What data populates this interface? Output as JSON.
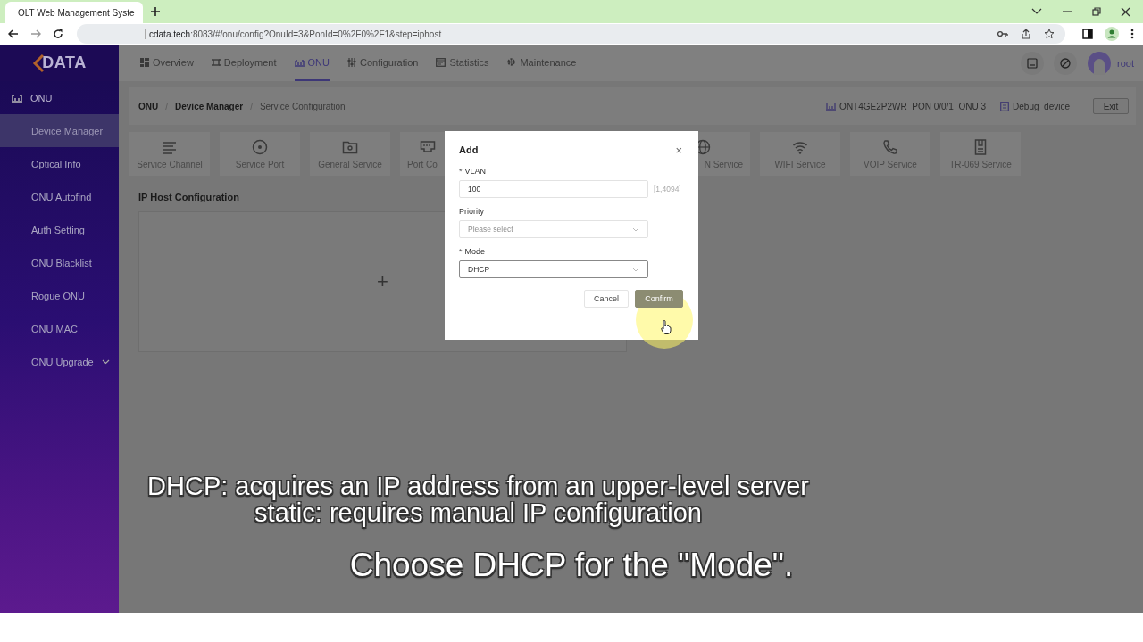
{
  "browser": {
    "tab_title": "OLT Web Management Syste",
    "url_host": "cdata.tech",
    "url_rest": ":8083/#/onu/config?OnuId=3&PonId=0%2F0%2F1&step=iphost"
  },
  "header": {
    "logo_text": "DATA",
    "nav": [
      {
        "label": "Overview",
        "selected": false
      },
      {
        "label": "Deployment",
        "selected": false
      },
      {
        "label": "ONU",
        "selected": true
      },
      {
        "label": "Configuration",
        "selected": false
      },
      {
        "label": "Statistics",
        "selected": false
      },
      {
        "label": "Maintenance",
        "selected": false
      }
    ],
    "user": "root"
  },
  "sidebar": {
    "title": "ONU",
    "items": [
      {
        "label": "Device Manager",
        "selected": true,
        "kind": "link"
      },
      {
        "label": "Optical Info",
        "selected": false,
        "kind": "link"
      },
      {
        "label": "ONU Autofind",
        "selected": false,
        "kind": "link"
      },
      {
        "label": "Auth Setting",
        "selected": false,
        "kind": "link"
      },
      {
        "label": "ONU Blacklist",
        "selected": false,
        "kind": "link"
      },
      {
        "label": "Rogue ONU",
        "selected": false,
        "kind": "link"
      },
      {
        "label": "ONU MAC",
        "selected": false,
        "kind": "link"
      },
      {
        "label": "ONU Upgrade",
        "selected": false,
        "kind": "submenu"
      }
    ]
  },
  "breadcrumb": [
    "ONU",
    "Device Manager",
    "Service Configuration"
  ],
  "breadcrumb_separator": "/",
  "device": {
    "name": "ONT4GE2P2WR_PON 0/0/1_ONU 3",
    "profile": "Debug_device",
    "exit": "Exit"
  },
  "service_tabs": [
    {
      "label": "Service Channel",
      "kind": "full"
    },
    {
      "label": "Service Port",
      "kind": "full"
    },
    {
      "label": "General Service",
      "kind": "full"
    },
    {
      "label": "Port Co",
      "kind": "cut_right"
    },
    {
      "label": "N Service",
      "kind": "cut_left"
    },
    {
      "label": "WIFI Service",
      "kind": "full"
    },
    {
      "label": "VOIP Service",
      "kind": "full"
    },
    {
      "label": "TR-069 Service",
      "kind": "full"
    }
  ],
  "section_title": "IP Host Configuration",
  "add_symbol": "+",
  "dialog": {
    "title": "Add",
    "close": "×",
    "required_mark": "*",
    "fields": [
      {
        "label": "VLAN",
        "required": true,
        "kind": "input",
        "value": "100",
        "hint": "[1,4094]"
      },
      {
        "label": "Priority",
        "required": false,
        "kind": "select",
        "placeholder": "Please select"
      },
      {
        "label": "Mode",
        "required": true,
        "kind": "select",
        "value": "DHCP"
      }
    ],
    "buttons": [
      {
        "label": "Cancel",
        "kind": "secondary"
      },
      {
        "label": "Confirm",
        "kind": "primary"
      }
    ]
  },
  "captions": [
    {
      "lines": [
        "DHCP: acquires an IP address from an upper-level server",
        "static: requires manual IP configuration"
      ],
      "kind": "note"
    },
    {
      "lines": [
        "Choose DHCP for the \"Mode\"."
      ],
      "kind": "subtitle"
    }
  ]
}
